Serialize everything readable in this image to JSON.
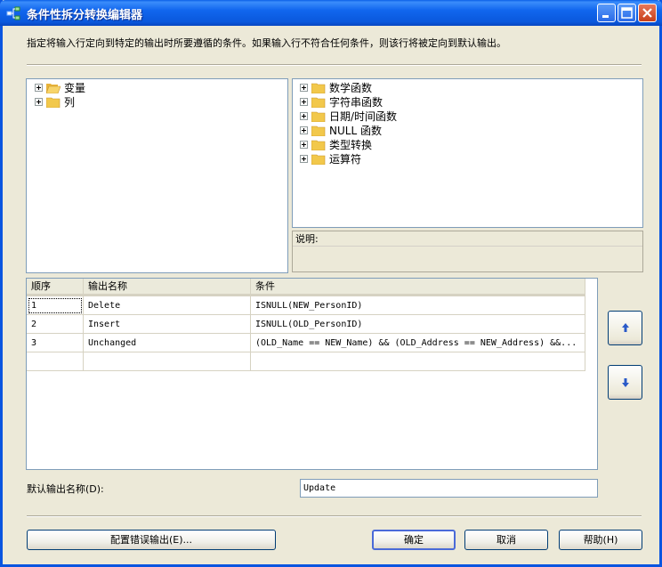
{
  "window": {
    "title": "条件性拆分转换编辑器"
  },
  "description": "指定将输入行定向到特定的输出时所要遵循的条件。如果输入行不符合任何条件，则该行将被定向到默认输出。",
  "left_tree": {
    "items": [
      {
        "label": "变量"
      },
      {
        "label": "列"
      }
    ]
  },
  "right_tree": {
    "items": [
      {
        "label": "数学函数"
      },
      {
        "label": "字符串函数"
      },
      {
        "label": "日期/时间函数"
      },
      {
        "label": "NULL 函数"
      },
      {
        "label": "类型转换"
      },
      {
        "label": "运算符"
      }
    ]
  },
  "description_pane": {
    "header": "说明:"
  },
  "grid": {
    "columns": [
      "顺序",
      "输出名称",
      "条件"
    ],
    "rows": [
      {
        "order": "1",
        "name": "Delete",
        "condition": "ISNULL(NEW_PersonID)"
      },
      {
        "order": "2",
        "name": "Insert",
        "condition": "ISNULL(OLD_PersonID)"
      },
      {
        "order": "3",
        "name": "Unchanged",
        "condition": "(OLD_Name == NEW_Name) && (OLD_Address == NEW_Address) &&..."
      }
    ]
  },
  "default_output": {
    "label": "默认输出名称(D):",
    "value": "Update"
  },
  "buttons": {
    "configure_error": "配置错误输出(E)...",
    "ok": "确定",
    "cancel": "取消",
    "help": "帮助(H)"
  },
  "colors": {
    "titlebar": "#0a58dc",
    "dialog_bg": "#ece9d8",
    "border": "#7f9db9",
    "folder": "#f2c84b"
  }
}
